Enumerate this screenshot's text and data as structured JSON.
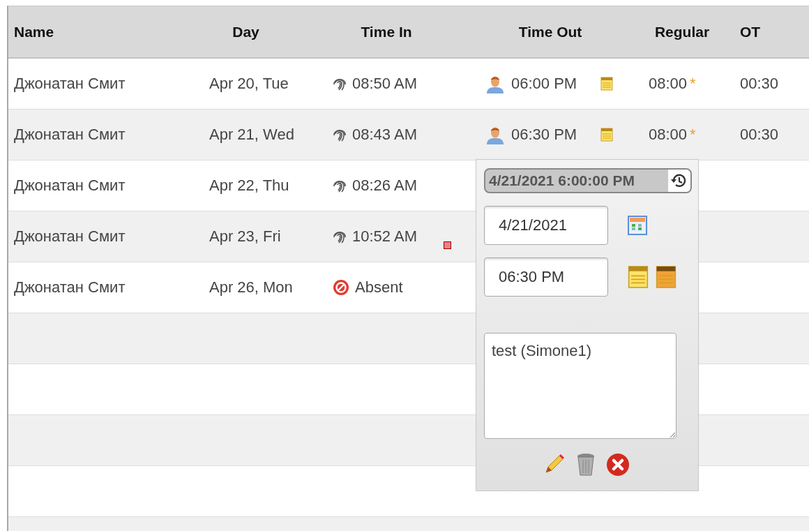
{
  "table": {
    "columns": [
      "Name",
      "Day",
      "Time In",
      "Time Out",
      "Regular",
      "OT"
    ],
    "rows": [
      {
        "name": "Джонатан Смит",
        "day": "Apr 20, Tue",
        "time_in": {
          "kind": "fingerprint",
          "text": "08:50 AM"
        },
        "flagged": false,
        "time_out": {
          "kind": "person",
          "text": "06:00 PM"
        },
        "note": true,
        "regular": "08:00",
        "regular_mark": "*",
        "ot": "00:30"
      },
      {
        "name": "Джонатан Смит",
        "day": "Apr 21, Wed",
        "time_in": {
          "kind": "fingerprint",
          "text": "08:43 AM"
        },
        "flagged": false,
        "time_out": {
          "kind": "person",
          "text": "06:30 PM"
        },
        "note": true,
        "regular": "08:00",
        "regular_mark": "*",
        "ot": "00:30"
      },
      {
        "name": "Джонатан Смит",
        "day": "Apr 22, Thu",
        "time_in": {
          "kind": "fingerprint",
          "text": "08:26 AM"
        },
        "flagged": false,
        "note": false
      },
      {
        "name": "Джонатан Смит",
        "day": "Apr 23, Fri",
        "time_in": {
          "kind": "fingerprint",
          "text": "10:52 AM"
        },
        "flagged": true,
        "note": false
      },
      {
        "name": "Джонатан Смит",
        "day": "Apr 26, Mon",
        "time_in": {
          "kind": "absent",
          "text": "Absent"
        },
        "flagged": false,
        "note": false
      }
    ]
  },
  "popup": {
    "original": "4/21/2021 6:00:00 PM",
    "date": "4/21/2021",
    "time": "06:30 PM",
    "comment": "test (Simone1)"
  }
}
